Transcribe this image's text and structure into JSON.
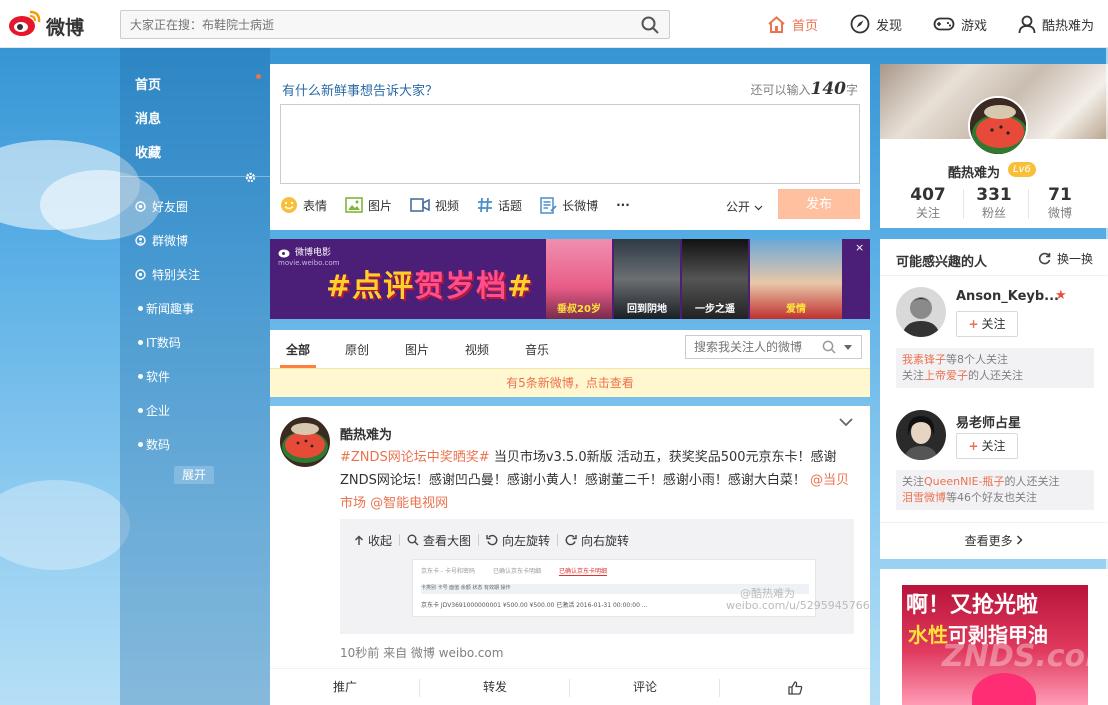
{
  "header": {
    "logo_text": "微博",
    "search_placeholder": "大家正在搜：布鞋院士病逝",
    "nav": [
      {
        "label": "首页",
        "icon": "home-icon"
      },
      {
        "label": "发现",
        "icon": "compass-icon"
      },
      {
        "label": "游戏",
        "icon": "gamepad-icon"
      },
      {
        "label": "酷热难为",
        "icon": "user-icon"
      }
    ]
  },
  "left_nav": {
    "main": [
      "首页",
      "消息",
      "收藏"
    ],
    "groups": [
      {
        "label": "好友圈",
        "icon": "friends-icon"
      },
      {
        "label": "群微博",
        "icon": "group-icon"
      },
      {
        "label": "特别关注",
        "icon": "star-icon"
      }
    ],
    "lists": [
      "新闻趣事",
      "IT数码",
      "软件",
      "企业",
      "数码"
    ],
    "expand_label": "展开"
  },
  "publisher": {
    "prompt": "有什么新鲜事想告诉大家？",
    "count_prefix": "还可以输入",
    "count_num": "140",
    "count_suffix": "字",
    "tools": [
      "表情",
      "图片",
      "视频",
      "话题",
      "长微博"
    ],
    "more": "···",
    "visibility": "公开",
    "submit": "发布"
  },
  "banner": {
    "brand": "微博电影",
    "brand_sub": "movie.weibo.com",
    "slogan_prefix": "#点评",
    "slogan_main": "贺岁档",
    "slogan_suffix": "#",
    "posters": [
      "垂叔20岁",
      "回到阴地",
      "一步之遥",
      "爱情"
    ],
    "close": "×"
  },
  "feed_tabs": {
    "tabs": [
      "全部",
      "原创",
      "图片",
      "视频",
      "音乐"
    ],
    "search_placeholder": "搜索我关注人的微博",
    "notice": "有5条新微博，点击查看"
  },
  "post": {
    "author": "酷热难为",
    "topic": "#ZNDS网论坛中奖晒奖#",
    "text": " 当贝市场v3.5.0新版 活动五，获奖奖品500元京东卡！感谢ZNDS网论坛！感谢凹凸曼！感谢小黄人！感谢董二千！感谢小雨！感谢大白菜！ ",
    "mentions": [
      "@当贝市场",
      "@智能电视网"
    ],
    "media_tools": [
      "收起",
      "查看大图",
      "向左旋转",
      "向右旋转"
    ],
    "thumb": {
      "tabs": [
        "京东卡 - 卡号和密码",
        "已确认京东卡明细",
        "已确认京东卡明细"
      ],
      "head": "卡类别    卡号    面值    余额    状态    有效期    操作",
      "line": "京东卡   JDV3691000000001   ¥500.00   ¥500.00   已激活   2016-01-31 00:00:00   ...",
      "watermark1": "@酷热难为",
      "watermark2": "weibo.com/u/5295945766"
    },
    "time": "10秒前 来自 微博 weibo.com",
    "actions": [
      "推广",
      "转发",
      "评论"
    ]
  },
  "profile": {
    "name": "酷热难为",
    "level": "Lv6",
    "stats": [
      {
        "num": "407",
        "label": "关注"
      },
      {
        "num": "331",
        "label": "粉丝"
      },
      {
        "num": "71",
        "label": "微博"
      }
    ]
  },
  "suggest": {
    "title": "可能感兴趣的人",
    "refresh": "换一换",
    "follow_label": "关注",
    "people": [
      {
        "name": "Anson_Keyb...",
        "reason_parts": [
          {
            "t": "我素锋子",
            "hl": true
          },
          {
            "t": "等8个人关注",
            "hl": false
          },
          {
            "t": "关注",
            "hl": false
          },
          {
            "t": "上帝爱子",
            "hl": true
          },
          {
            "t": "的人还关注",
            "hl": false
          }
        ]
      },
      {
        "name": "易老师占星",
        "reason_parts": [
          {
            "t": "关注",
            "hl": false
          },
          {
            "t": "QueenNIE-瓶子",
            "hl": true
          },
          {
            "t": "的人还关注",
            "hl": false
          },
          {
            "t": "泪雪微博",
            "hl": true
          },
          {
            "t": "等46个好友也关注",
            "hl": false
          }
        ]
      }
    ],
    "more": "查看更多"
  },
  "ad": {
    "line1": "啊！又抢光啦",
    "line2_a": "水性",
    "line2_b": "可剥",
    "line2_c": "指甲油",
    "watermark": "ZNDS.com"
  },
  "colors": {
    "accent": "#eb7350",
    "link_blue": "#2a6aa5",
    "submit_disabled": "#ffc09f",
    "notice_bg": "#fff7cf"
  }
}
